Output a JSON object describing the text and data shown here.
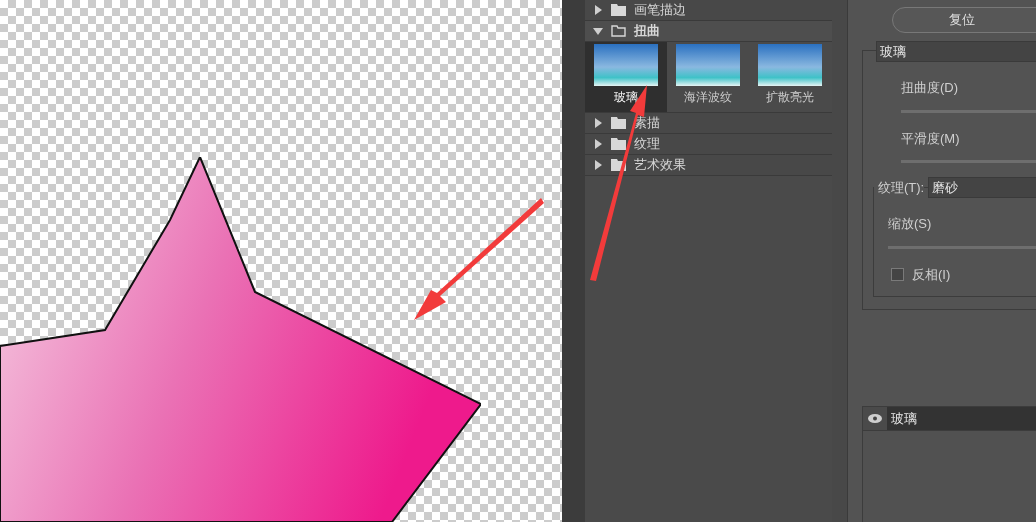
{
  "categories": [
    {
      "name": "画笔描边",
      "expanded": false
    },
    {
      "name": "扭曲",
      "expanded": true,
      "filters": [
        {
          "name": "玻璃",
          "selected": true
        },
        {
          "name": "海洋波纹",
          "selected": false
        },
        {
          "name": "扩散亮光",
          "selected": false
        }
      ]
    },
    {
      "name": "素描",
      "expanded": false
    },
    {
      "name": "纹理",
      "expanded": false
    },
    {
      "name": "艺术效果",
      "expanded": false
    }
  ],
  "settings": {
    "reset_button": "复位",
    "filter_select": "玻璃",
    "sliders": [
      {
        "label": "扭曲度(D)"
      },
      {
        "label": "平滑度(M)"
      }
    ],
    "texture": {
      "label": "纹理(T):",
      "value": "磨砂",
      "sliders": [
        {
          "label": "缩放(S)"
        }
      ],
      "invert": {
        "label": "反相(I)",
        "checked": false
      }
    }
  },
  "layers": [
    {
      "name": "玻璃",
      "visible": true
    }
  ]
}
